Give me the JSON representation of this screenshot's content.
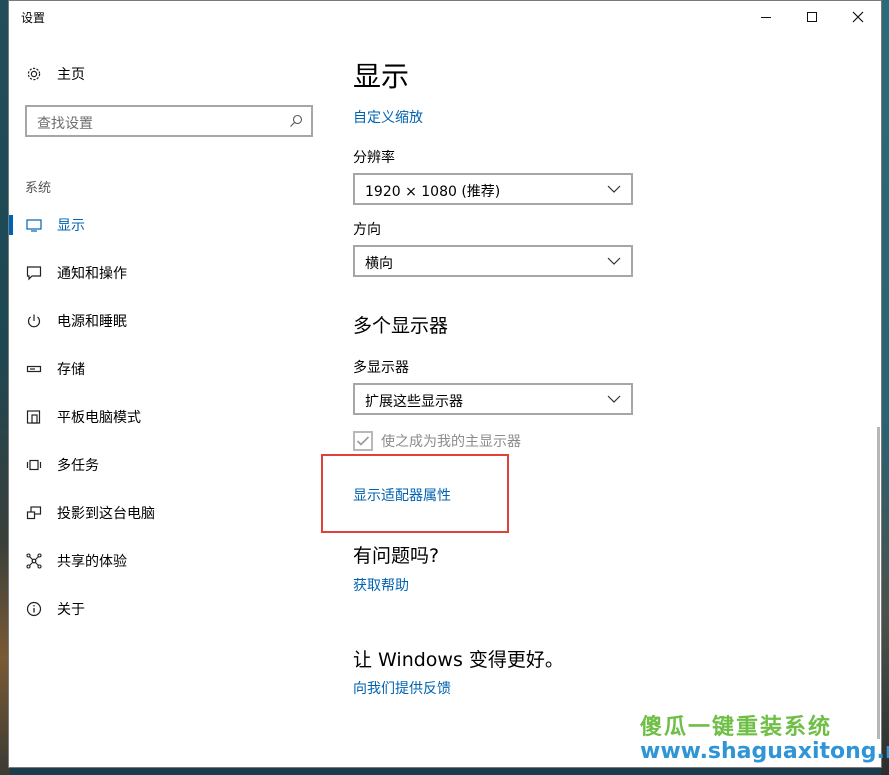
{
  "window": {
    "title": "设置"
  },
  "sidebar": {
    "home_label": "主页",
    "search_placeholder": "查找设置",
    "section_label": "系统",
    "items": [
      {
        "label": "显示",
        "icon": "monitor-icon",
        "active": true
      },
      {
        "label": "通知和操作",
        "icon": "notification-icon",
        "active": false
      },
      {
        "label": "电源和睡眠",
        "icon": "power-icon",
        "active": false
      },
      {
        "label": "存储",
        "icon": "storage-icon",
        "active": false
      },
      {
        "label": "平板电脑模式",
        "icon": "tablet-mode-icon",
        "active": false
      },
      {
        "label": "多任务",
        "icon": "multitasking-icon",
        "active": false
      },
      {
        "label": "投影到这台电脑",
        "icon": "projecting-icon",
        "active": false
      },
      {
        "label": "共享的体验",
        "icon": "shared-experience-icon",
        "active": false
      },
      {
        "label": "关于",
        "icon": "info-icon",
        "active": false
      }
    ]
  },
  "main": {
    "title": "显示",
    "custom_scaling_link": "自定义缩放",
    "resolution_label": "分辨率",
    "resolution_value": "1920 × 1080 (推荐)",
    "orientation_label": "方向",
    "orientation_value": "横向",
    "multi_display_heading": "多个显示器",
    "multi_display_label": "多显示器",
    "multi_display_value": "扩展这些显示器",
    "main_display_checkbox_label": "使之成为我的主显示器",
    "main_display_checked": true,
    "adapter_link": "显示适配器属性",
    "question_heading": "有问题吗?",
    "help_link": "获取帮助",
    "improve_heading": "让 Windows 变得更好。",
    "feedback_link": "向我们提供反馈"
  },
  "watermark": {
    "line1": "傻瓜一键重装系统",
    "line2": "www.shaguaxitong.net"
  },
  "colors": {
    "accent": "#0063b1",
    "highlight_border": "#e0413a"
  }
}
